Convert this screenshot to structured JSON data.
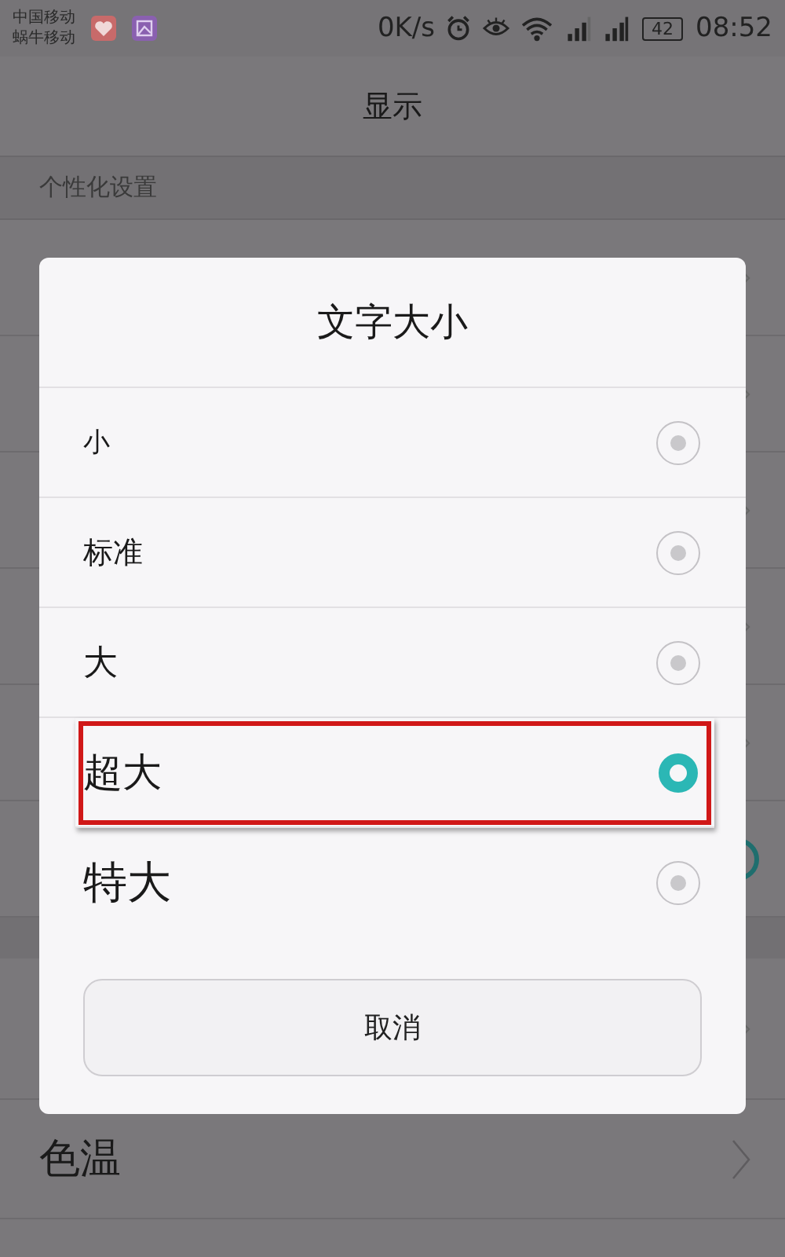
{
  "status_bar": {
    "carriers": [
      "中国移动",
      "蜗牛移动"
    ],
    "speed": "0K/s",
    "battery": "42",
    "time": "08:52"
  },
  "header": {
    "title": "显示"
  },
  "section": {
    "label": "个性化设置"
  },
  "bottom_row": {
    "label": "色温"
  },
  "dialog": {
    "title": "文字大小",
    "options": [
      {
        "label": "小",
        "selected": false,
        "highlighted": false
      },
      {
        "label": "标准",
        "selected": false,
        "highlighted": false
      },
      {
        "label": "大",
        "selected": false,
        "highlighted": false
      },
      {
        "label": "超大",
        "selected": true,
        "highlighted": true
      },
      {
        "label": "特大",
        "selected": false,
        "highlighted": false
      }
    ],
    "cancel": "取消"
  }
}
